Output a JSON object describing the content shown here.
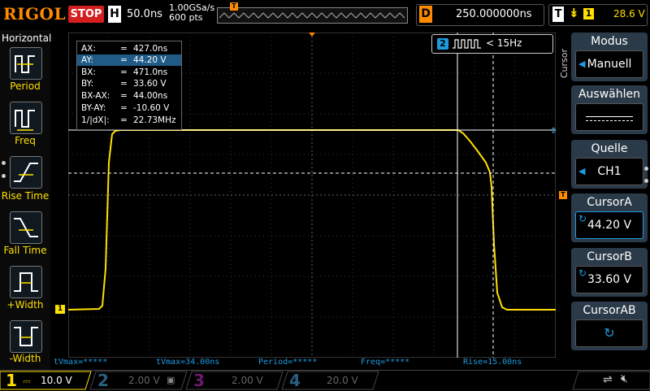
{
  "brand": "RIGOL",
  "run_state": "STOP",
  "timebase": {
    "label": "H",
    "value": "50.0ns"
  },
  "sampling": {
    "rate": "1.00GSa/s",
    "points": "600 pts"
  },
  "trigger_marker": "T",
  "delay": {
    "label": "D",
    "value": "250.000000ns"
  },
  "trigger": {
    "label": "T",
    "slope": "↡",
    "channel": "1",
    "level": "28.6 V"
  },
  "left_menu": {
    "title": "Horizontal",
    "items": [
      {
        "label": "Period"
      },
      {
        "label": "Freq"
      },
      {
        "label": "Rise Time"
      },
      {
        "label": "Fall Time"
      },
      {
        "label": "+Width"
      },
      {
        "label": "-Width"
      }
    ]
  },
  "cursor_table": [
    {
      "key": "AX:",
      "eq": "=",
      "value": "427.0ns"
    },
    {
      "key": "AY:",
      "eq": "=",
      "value": "44.20 V"
    },
    {
      "key": "BX:",
      "eq": "=",
      "value": "471.0ns"
    },
    {
      "key": "BY:",
      "eq": "=",
      "value": "33.60 V"
    },
    {
      "key": "BX-AX:",
      "eq": "=",
      "value": "44.00ns"
    },
    {
      "key": "BY-AY:",
      "eq": "=",
      "value": "-10.60 V"
    },
    {
      "key": "1/|dX|:",
      "eq": "=",
      "value": "22.73MHz"
    }
  ],
  "freq_counter": {
    "channel": "2",
    "text": "< 15Hz"
  },
  "measurements": [
    {
      "text": "tVmax=*****"
    },
    {
      "text": "tVmax=34.00ns"
    },
    {
      "text": "Period=*****"
    },
    {
      "text": "Freq=*****"
    },
    {
      "text": "Rise=15.00ns"
    }
  ],
  "right_menu": {
    "vertical_label": "Cursor",
    "modus": {
      "title": "Modus",
      "value": "Manuell"
    },
    "auswaehlen": {
      "title": "Auswählen"
    },
    "quelle": {
      "title": "Quelle",
      "value": "CH1"
    },
    "cursor_a": {
      "title": "CursorA",
      "value": "44.20 V"
    },
    "cursor_b": {
      "title": "CursorB",
      "value": "33.60 V"
    },
    "cursor_ab": {
      "title": "CursorAB"
    }
  },
  "channels": [
    {
      "num": "1",
      "value": "10.0 V",
      "color": "#ffe000"
    },
    {
      "num": "2",
      "value": "2.00 V",
      "color": "#1e9be0"
    },
    {
      "num": "3",
      "value": "2.00 V",
      "color": "#d014d0"
    },
    {
      "num": "4",
      "value": "20.0 V",
      "color": "#1e9be0"
    }
  ],
  "ch1_marker": "1",
  "colors": {
    "accent": "#ff8a00",
    "ch1": "#ffe000",
    "menu_bg": "#2b3a48",
    "stop": "#d51f1f"
  }
}
